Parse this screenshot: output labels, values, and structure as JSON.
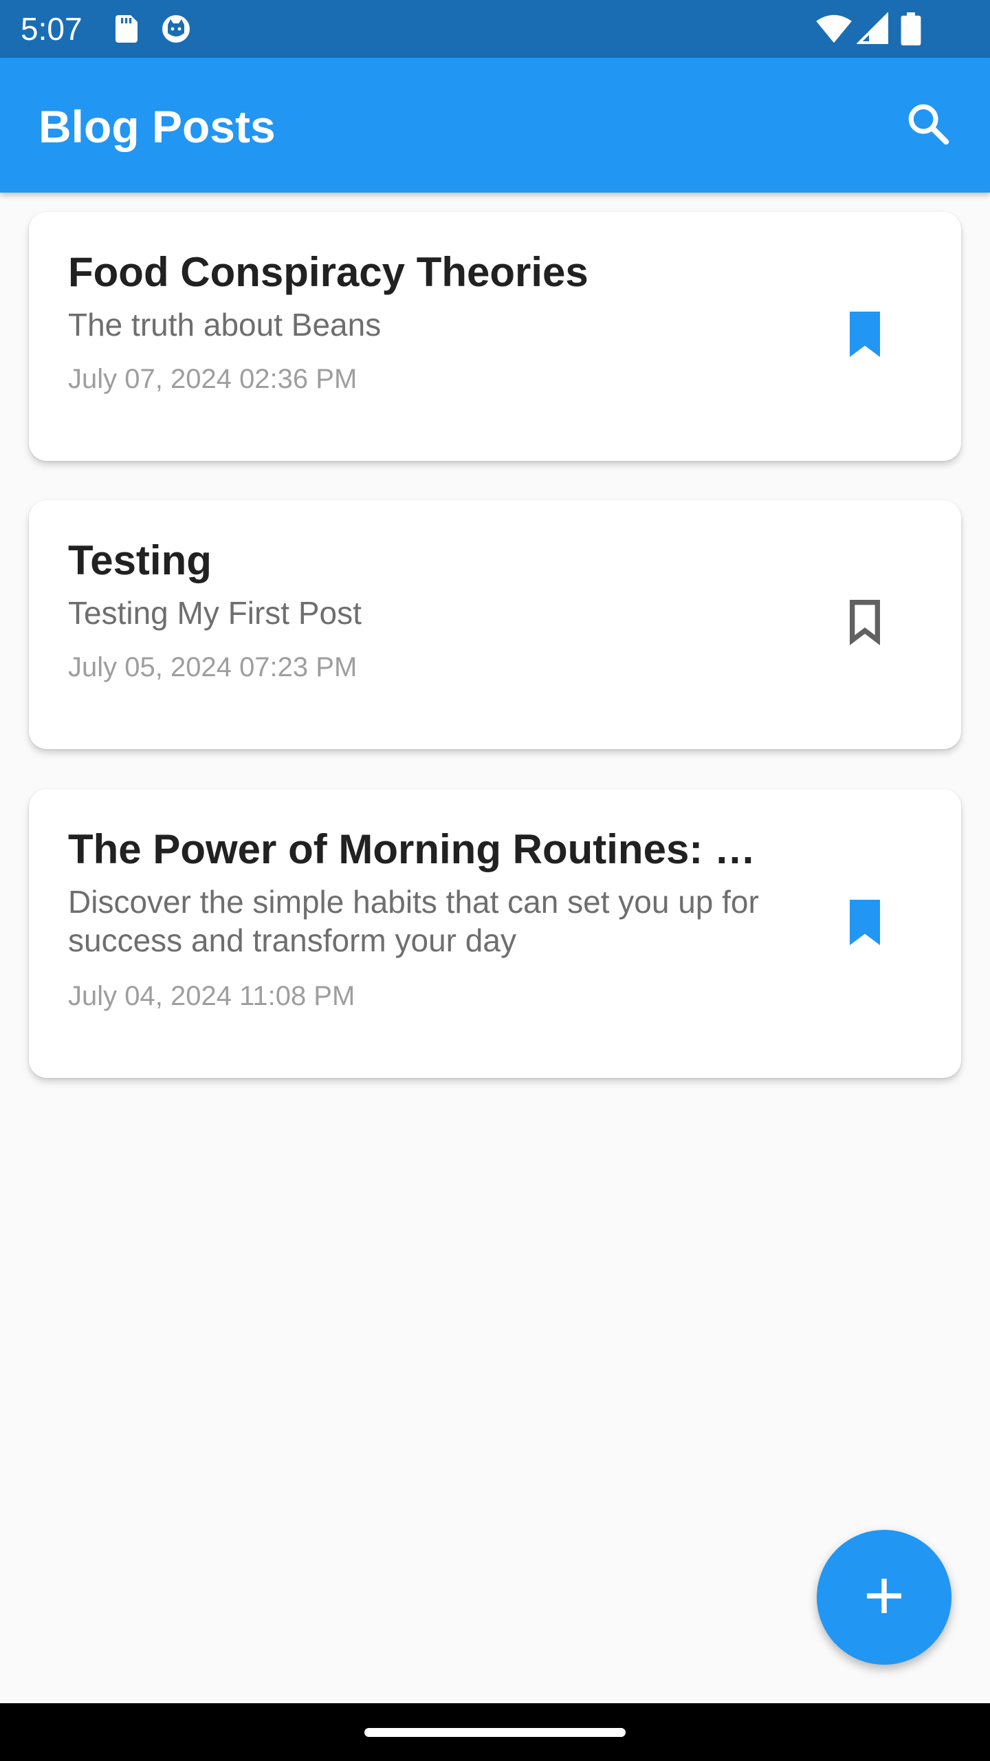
{
  "status_bar": {
    "time": "5:07",
    "icons_left": [
      "sd-card-icon",
      "cat-app-icon"
    ],
    "icons_right": [
      "wifi-icon",
      "cell-signal-icon",
      "battery-icon"
    ]
  },
  "app_bar": {
    "title": "Blog Posts",
    "action_icon": "search-icon",
    "color": "#2196f3"
  },
  "posts": [
    {
      "title": "Food Conspiracy Theories",
      "description": "The truth about Beans",
      "date": "July 07, 2024 02:36 PM",
      "bookmarked": true
    },
    {
      "title": "Testing",
      "description": "Testing My First Post",
      "date": "July 05, 2024 07:23 PM",
      "bookmarked": false
    },
    {
      "title": "The Power of Morning Routines: …",
      "description": "Discover the simple habits that can set you up for success and transform your day",
      "date": "July 04, 2024 11:08 PM",
      "bookmarked": true
    }
  ],
  "fab": {
    "icon": "plus-icon"
  },
  "colors": {
    "status_bar": "#1a6db3",
    "accent": "#2196f3",
    "bookmark_active": "#2196f3",
    "bookmark_inactive": "#616161"
  }
}
